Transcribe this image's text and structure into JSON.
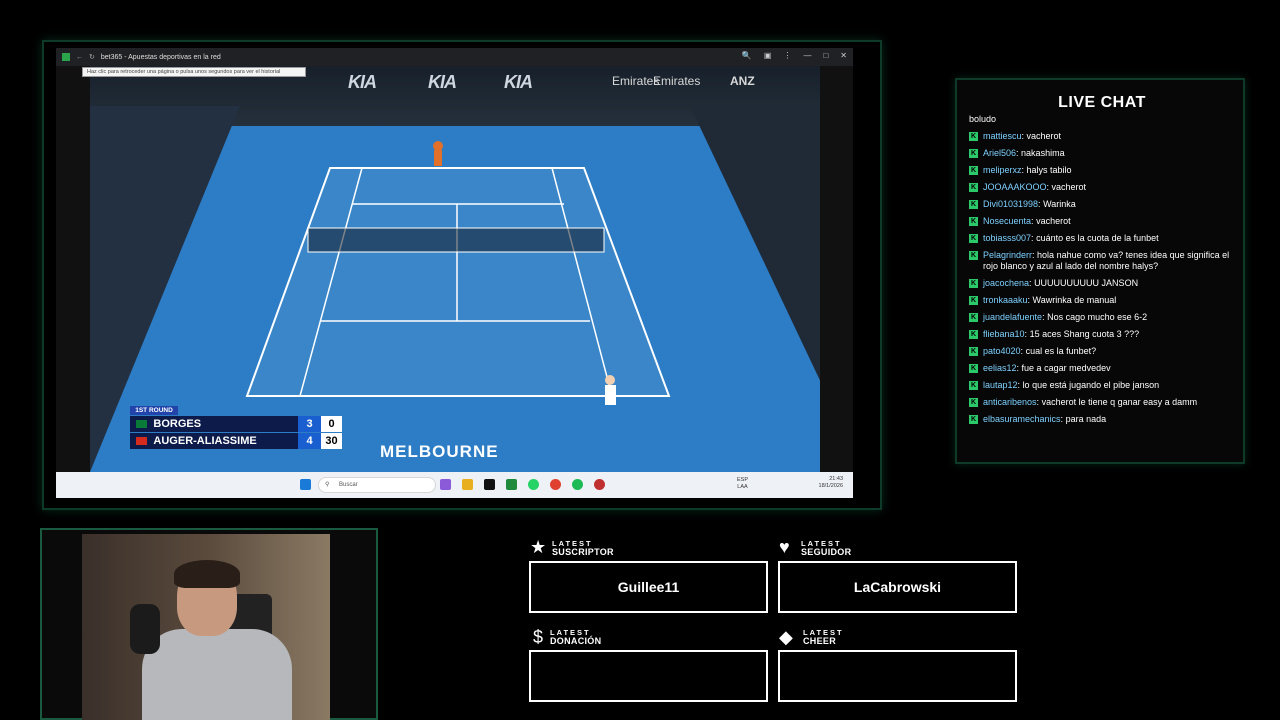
{
  "browser": {
    "title": "bet365 - Apuestas deportivas en la red",
    "tooltip": "Haz clic para retroceder una página o pulsa unos segundos para ver el historial"
  },
  "broadcast": {
    "round": "1ST ROUND",
    "players": [
      {
        "name": "BORGES",
        "sets": "3",
        "points": "0",
        "flag_color": "#0a7a3a"
      },
      {
        "name": "AUGER-ALIASSIME",
        "sets": "4",
        "points": "30",
        "flag_color": "#d52b1e"
      }
    ],
    "venue": "MELBOURNE",
    "sponsors": [
      "KIA",
      "KIA",
      "KIA",
      "Emirates",
      "Emirates",
      "ANZ"
    ]
  },
  "taskbar": {
    "search_placeholder": "Buscar",
    "lang_top": "ESP",
    "lang_bottom": "LAA",
    "time": "21:43",
    "date": "18/1/2026"
  },
  "chat": {
    "title": "LIVE CHAT",
    "partial_top": "boludo",
    "messages": [
      {
        "user": "mattiescu",
        "text": "vacherot"
      },
      {
        "user": "Ariel506",
        "text": "nakashima"
      },
      {
        "user": "meliperxz",
        "text": "halys tabilo"
      },
      {
        "user": "JOOAAAKOOO",
        "text": "vacherot"
      },
      {
        "user": "Divi01031998",
        "text": "Warinka"
      },
      {
        "user": "Nosecuenta",
        "text": "vacherot"
      },
      {
        "user": "tobiasss007",
        "text": "cuánto es la cuota de la funbet"
      },
      {
        "user": "Pelagrinderr",
        "text": "hola nahue como va? tenes idea que significa el rojo blanco y azul al lado del nombre halys?"
      },
      {
        "user": "joacochena",
        "text": "UUUUUUUUUU JANSON"
      },
      {
        "user": "tronkaaaku",
        "text": "Wawrinka de manual"
      },
      {
        "user": "juandelafuente",
        "text": "Nos cago mucho ese 6-2"
      },
      {
        "user": "fliebana10",
        "text": "15 aces Shang cuota 3 ???"
      },
      {
        "user": "pato4020",
        "text": "cual es la funbet?"
      },
      {
        "user": "eelias12",
        "text": "fue a cagar medvedev"
      },
      {
        "user": "lautap12",
        "text": "lo que está jugando el pibe janson"
      },
      {
        "user": "anticaribenos",
        "text": "vacherot le tiene q ganar easy a damm"
      },
      {
        "user": "elbasuramechanics",
        "text": "para nada"
      }
    ]
  },
  "widgets": {
    "suscriptor": {
      "small": "LATEST",
      "label": "SUSCRIPTOR",
      "value": "Guillee11"
    },
    "seguidor": {
      "small": "LATEST",
      "label": "SEGUIDOR",
      "value": "LaCabrowski"
    },
    "donacion": {
      "small": "LATEST",
      "label": "DONACIÓN",
      "value": ""
    },
    "cheer": {
      "small": "LATEST",
      "label": "CHEER",
      "value": ""
    }
  }
}
